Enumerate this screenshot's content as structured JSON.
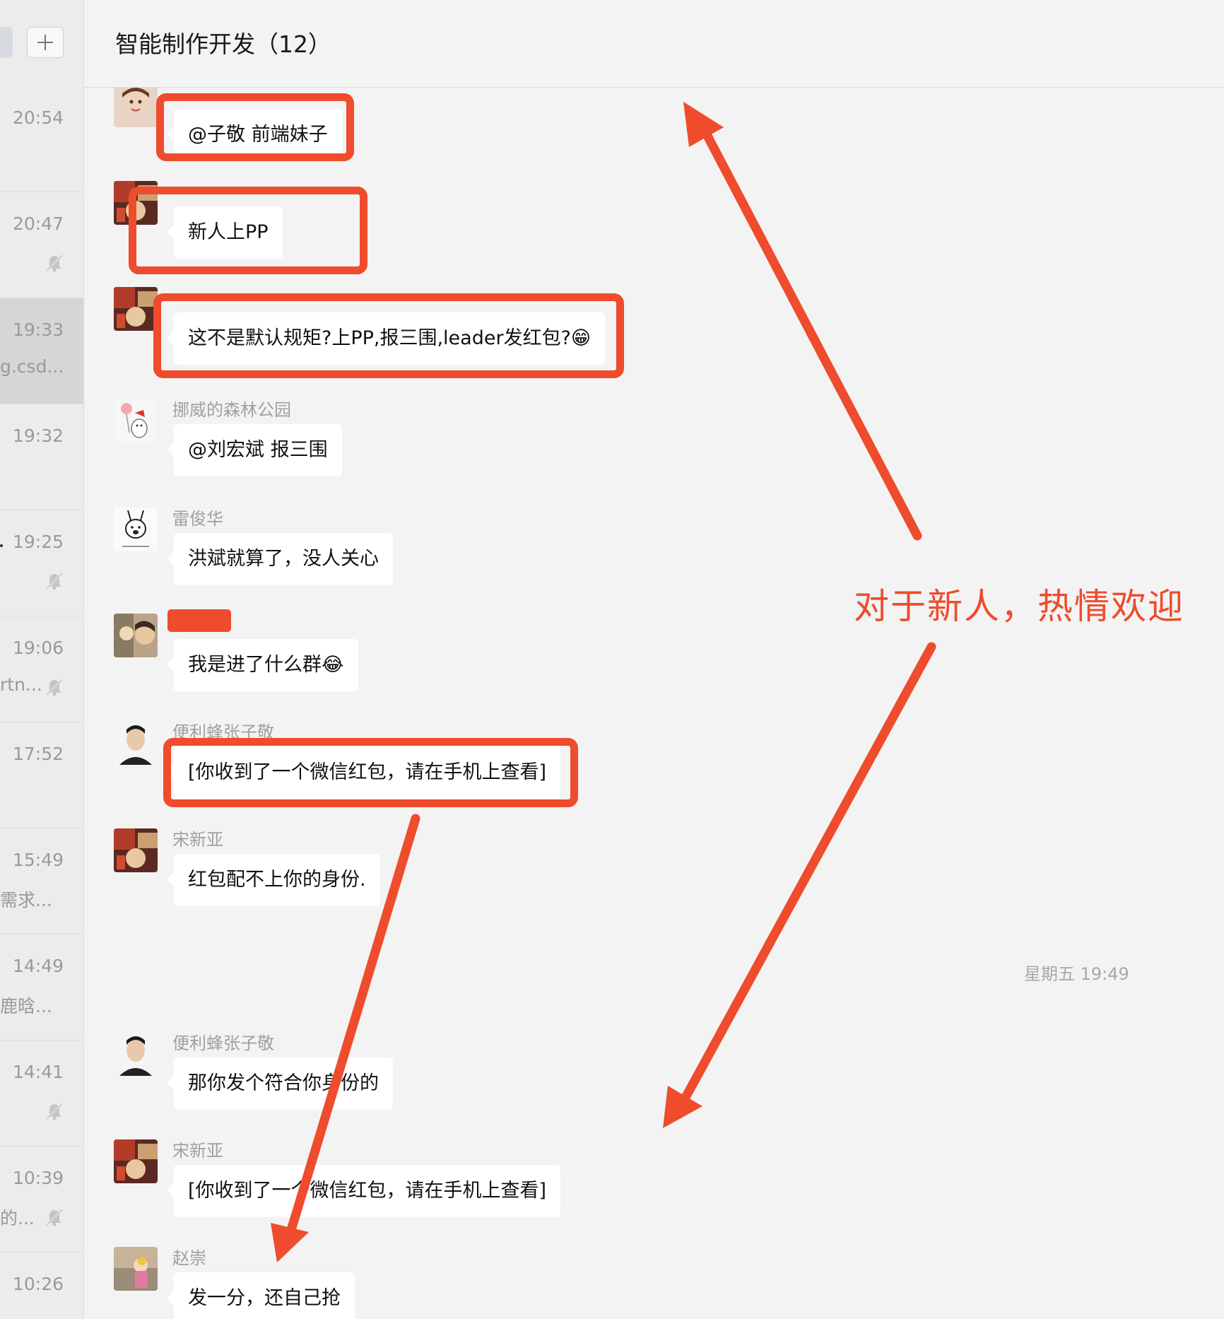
{
  "sidebar": {
    "conversations": [
      {
        "time": "20:54",
        "preview": "",
        "muted": false,
        "active": false
      },
      {
        "time": "20:47",
        "preview": "",
        "muted": true,
        "active": false
      },
      {
        "time": "19:33",
        "preview": "g.csd...",
        "muted": false,
        "active": true
      },
      {
        "time": "19:32",
        "preview": "",
        "muted": false,
        "active": false
      },
      {
        "time": "19:25",
        "preview": "",
        "muted": true,
        "active": false
      },
      {
        "time": "19:06",
        "preview": "rtn...",
        "muted": true,
        "active": false
      },
      {
        "time": "17:52",
        "preview": "",
        "muted": false,
        "active": false
      },
      {
        "time": "15:49",
        "preview": "需求...",
        "muted": false,
        "active": false
      },
      {
        "time": "14:49",
        "preview": "鹿晗...",
        "muted": false,
        "active": false
      },
      {
        "time": "14:41",
        "preview": "",
        "muted": true,
        "active": false
      },
      {
        "time": "10:39",
        "preview": "的...",
        "muted": true,
        "active": false
      },
      {
        "time": "10:26",
        "preview": "",
        "muted": false,
        "active": false
      }
    ]
  },
  "header": {
    "title": "智能制作开发（12）"
  },
  "messages": [
    {
      "sender": "",
      "text": "@子敬 前端妹子"
    },
    {
      "sender": "",
      "text": "新人上PP"
    },
    {
      "sender": "",
      "text": "这不是默认规矩?上PP,报三围,leader发红包?😁"
    },
    {
      "sender": "挪威的森林公园",
      "text": "@刘宏斌 报三围"
    },
    {
      "sender": "雷俊华",
      "text": "洪斌就算了，没人关心"
    },
    {
      "sender": "",
      "text": "我是进了什么群😂"
    },
    {
      "sender": "便利蜂张子敬",
      "text": "[你收到了一个微信红包，请在手机上查看]"
    },
    {
      "sender": "宋新亚",
      "text": "红包配不上你的身份."
    },
    {
      "sender": "便利蜂张子敬",
      "text": "那你发个符合你身份的"
    },
    {
      "sender": "宋新亚",
      "text": "[你收到了一个微信红包，请在手机上查看]"
    },
    {
      "sender": "赵崇",
      "text": "发一分，还自己抢"
    }
  ],
  "timestamp": "星期五 19:49",
  "annotation": {
    "text": "对于新人，热情欢迎",
    "color": "#ee4c2c"
  },
  "icons": {
    "add": "plus-icon",
    "mute": "bell-mute-icon"
  }
}
